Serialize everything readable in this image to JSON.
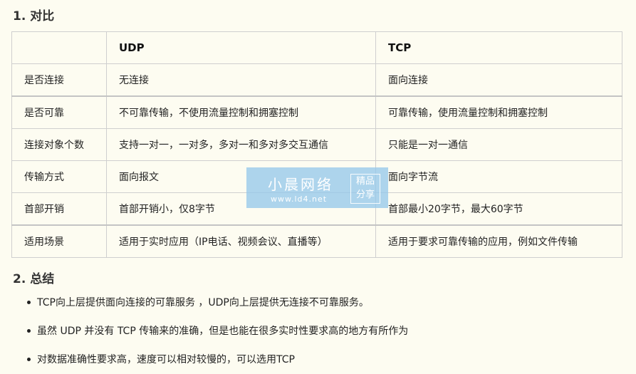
{
  "section1": {
    "title": "1. 对比"
  },
  "table": {
    "headers": [
      "",
      "UDP",
      "TCP"
    ],
    "rows": [
      [
        "是否连接",
        "无连接",
        "面向连接"
      ],
      [
        "是否可靠",
        "不可靠传输，不使用流量控制和拥塞控制",
        "可靠传输，使用流量控制和拥塞控制"
      ],
      [
        "连接对象个数",
        "支持一对一，一对多，多对一和多对多交互通信",
        "只能是一对一通信"
      ],
      [
        "传输方式",
        "面向报文",
        "面向字节流"
      ],
      [
        "首部开销",
        "首部开销小，仅8字节",
        "首部最小20字节，最大60字节"
      ],
      [
        "适用场景",
        "适用于实时应用（IP电话、视频会议、直播等）",
        "适用于要求可靠传输的应用，例如文件传输"
      ]
    ]
  },
  "section2": {
    "title": "2. 总结"
  },
  "summary": {
    "items": [
      "TCP向上层提供面向连接的可靠服务 ，UDP向上层提供无连接不可靠服务。",
      "虽然 UDP 并没有 TCP 传输来的准确，但是也能在很多实时性要求高的地方有所作为",
      "对数据准确性要求高，速度可以相对较慢的，可以选用TCP"
    ]
  },
  "watermark": {
    "title": "小晨网络",
    "url": "www.ld4.net",
    "badge_line1": "精品",
    "badge_line2": "分享"
  }
}
